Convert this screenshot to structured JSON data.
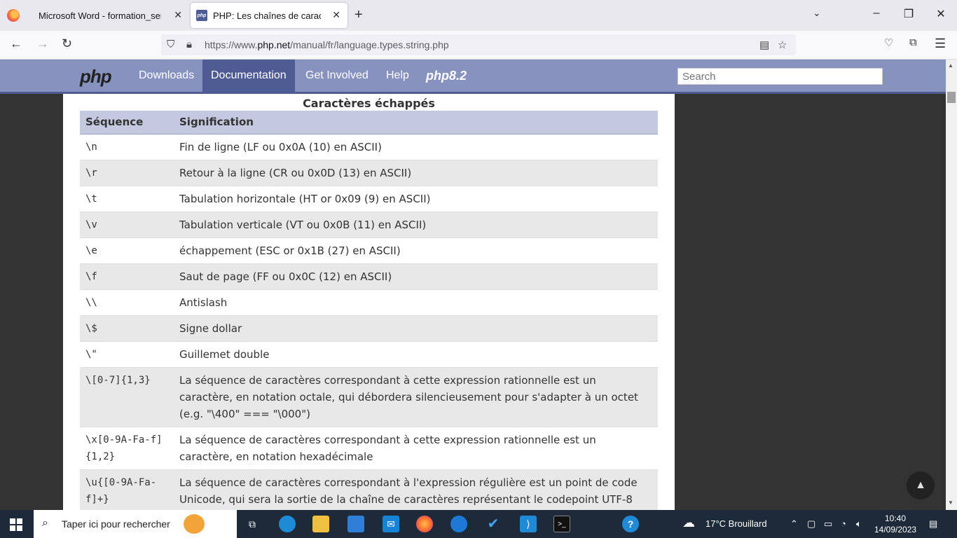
{
  "browser": {
    "tabs": [
      {
        "title": "Microsoft Word - formation_semaine"
      },
      {
        "title": "PHP: Les chaînes de caractères"
      }
    ],
    "url_prefix": "https://www.",
    "url_domain": "php.net",
    "url_path": "/manual/fr/language.types.string.php"
  },
  "php_header": {
    "logo": "php",
    "menu": [
      "Downloads",
      "Documentation",
      "Get Involved",
      "Help"
    ],
    "version_badge": "php8.2",
    "search_placeholder": "Search"
  },
  "table": {
    "caption": "Caractères échappés",
    "headers": [
      "Séquence",
      "Signification"
    ],
    "rows": [
      {
        "seq": "\\n",
        "meaning": "Fin de ligne (LF ou 0x0A (10) en ASCII)"
      },
      {
        "seq": "\\r",
        "meaning": "Retour à la ligne (CR ou 0x0D (13) en ASCII)"
      },
      {
        "seq": "\\t",
        "meaning": "Tabulation horizontale (HT or 0x09 (9) en ASCII)"
      },
      {
        "seq": "\\v",
        "meaning": "Tabulation verticale (VT ou 0x0B (11) en ASCII)"
      },
      {
        "seq": "\\e",
        "meaning": "échappement (ESC or 0x1B (27) en ASCII)"
      },
      {
        "seq": "\\f",
        "meaning": "Saut de page (FF ou 0x0C (12) en ASCII)"
      },
      {
        "seq": "\\\\",
        "meaning": "Antislash"
      },
      {
        "seq": "\\$",
        "meaning": "Signe dollar"
      },
      {
        "seq": "\\\"",
        "meaning": "Guillemet double"
      },
      {
        "seq": "\\[0-7]{1,3}",
        "meaning": "La séquence de caractères correspondant à cette expression rationnelle est un caractère, en notation octale, qui débordera silencieusement pour s'adapter à un octet (e.g. \"\\400\" === \"\\000\")"
      },
      {
        "seq": "\\x[0-9A-Fa-f]{1,2}",
        "meaning": "La séquence de caractères correspondant à cette expression rationnelle est un caractère, en notation hexadécimale"
      },
      {
        "seq": "\\u{[0-9A-Fa-f]+}",
        "meaning": "La séquence de caractères correspondant à l'expression régulière est un point de code Unicode, qui sera la sortie de la chaîne de caractères représentant le codepoint UTF-8"
      }
    ]
  },
  "taskbar": {
    "search_placeholder": "Taper ici pour rechercher",
    "weather": "17°C  Brouillard",
    "time": "10:40",
    "date": "14/09/2023"
  }
}
